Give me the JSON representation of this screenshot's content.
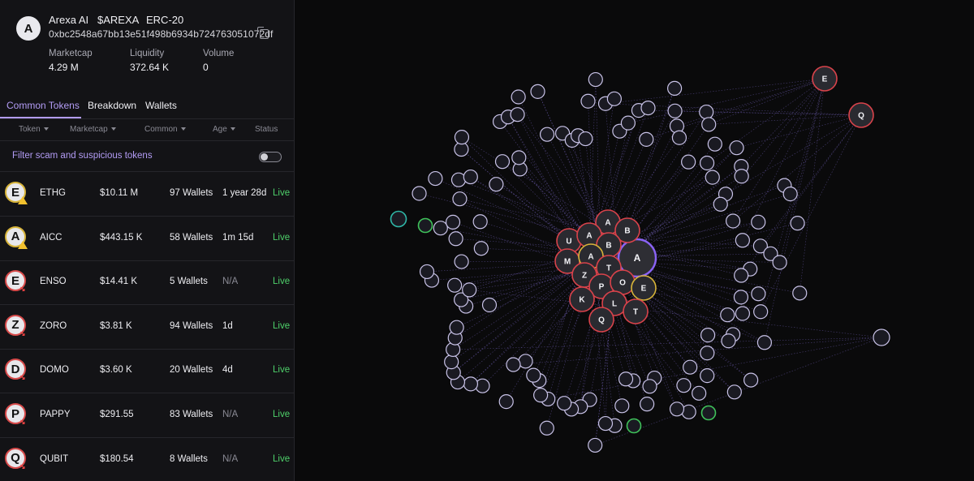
{
  "token": {
    "avatar_letter": "A",
    "name": "Arexa AI",
    "symbol": "$AREXA",
    "standard": "ERC-20",
    "address": "0xbc2548a67bb13e51f498b6934b724763051072df",
    "copy_icon": "copy-icon"
  },
  "stats": {
    "marketcap_label": "Marketcap",
    "marketcap_value": "4.29 M",
    "liquidity_label": "Liquidity",
    "liquidity_value": "372.64 K",
    "volume_label": "Volume",
    "volume_value": "0"
  },
  "tabs": [
    {
      "label": "Common Tokens",
      "active": true
    },
    {
      "label": "Breakdown",
      "active": false
    },
    {
      "label": "Wallets",
      "active": false
    }
  ],
  "columns": [
    "Token",
    "Marketcap",
    "Common",
    "Age",
    "Status"
  ],
  "filter": {
    "label": "Filter scam and suspicious tokens",
    "enabled": false
  },
  "rows": [
    {
      "letter": "E",
      "name": "ETHG",
      "marketcap": "$10.11 M",
      "common": "97 Wallets",
      "age": "1 year 28d",
      "status": "Live",
      "flag": "warn"
    },
    {
      "letter": "A",
      "name": "AICC",
      "marketcap": "$443.15 K",
      "common": "58 Wallets",
      "age": "1m 15d",
      "status": "Live",
      "flag": "warn"
    },
    {
      "letter": "E",
      "name": "ENSO",
      "marketcap": "$14.41 K",
      "common": "5 Wallets",
      "age": "N/A",
      "status": "Live",
      "flag": "down"
    },
    {
      "letter": "Z",
      "name": "ZORO",
      "marketcap": "$3.81 K",
      "common": "94 Wallets",
      "age": "1d",
      "status": "Live",
      "flag": "down"
    },
    {
      "letter": "D",
      "name": "DOMO",
      "marketcap": "$3.60 K",
      "common": "20 Wallets",
      "age": "4d",
      "status": "Live",
      "flag": "down"
    },
    {
      "letter": "P",
      "name": "PAPPY",
      "marketcap": "$291.55",
      "common": "83 Wallets",
      "age": "N/A",
      "status": "Live",
      "flag": "down"
    },
    {
      "letter": "Q",
      "name": "QUBIT",
      "marketcap": "$180.54",
      "common": "8 Wallets",
      "age": "N/A",
      "status": "Live",
      "flag": "down"
    }
  ],
  "graph": {
    "center_label": "A",
    "cluster_labels": [
      "A",
      "B",
      "U",
      "A",
      "B",
      "M",
      "A",
      "T",
      "Z",
      "P",
      "O",
      "E",
      "K",
      "L",
      "T",
      "Q"
    ],
    "outer_labels": [
      "E",
      "Q"
    ],
    "colors": {
      "edge": "#7a68c8",
      "wallet_fill": "#1a1a22",
      "wallet_stroke": "#c9c3e8",
      "token_down": "#d9434b",
      "token_warn": "#d7b43a",
      "accent": "#8a63f5",
      "green": "#3fc25a",
      "teal": "#2fb8a8"
    }
  }
}
